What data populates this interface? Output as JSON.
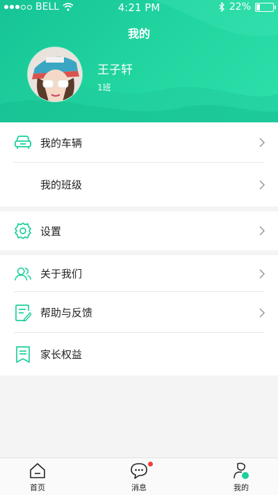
{
  "status_bar": {
    "carrier": "BELL",
    "time": "4:21 PM",
    "battery": "22%"
  },
  "header": {
    "title": "我的"
  },
  "profile": {
    "name": "王子轩",
    "class_name": "1班"
  },
  "menu": {
    "my_vehicle": "我的车辆",
    "my_class": "我的班级",
    "settings": "设置",
    "about_us": "关于我们",
    "help_feedback": "帮助与反馈",
    "parent_rights": "家长权益"
  },
  "tabbar": {
    "home": "首页",
    "messages": "消息",
    "mine": "我的"
  },
  "colors": {
    "accent": "#1ccf9d",
    "badge": "#f04040"
  },
  "icons": [
    "car-icon",
    "gear-icon",
    "people-icon",
    "edit-doc-icon",
    "bookmark-icon",
    "home-icon",
    "chat-icon",
    "profile-icon"
  ]
}
